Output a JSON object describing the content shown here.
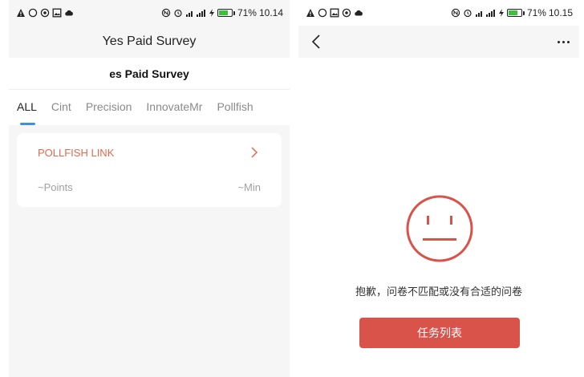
{
  "left_phone": {
    "status_bar": {
      "icons": [
        "warning-icon",
        "chat-bubble-icon",
        "circle-badge-icon",
        "image-icon",
        "cloud-icon"
      ],
      "right_icons": [
        "nfc-icon",
        "alarm-icon",
        "signal-icon",
        "charging-icon"
      ],
      "battery_percent": "71%",
      "battery_level": 0.71,
      "time": "10.14"
    },
    "app_title": "Yes Paid Survey",
    "subtitle": "es Paid Survey",
    "tabs": [
      {
        "label": "ALL",
        "active": true
      },
      {
        "label": "Cint",
        "active": false
      },
      {
        "label": "Precision",
        "active": false
      },
      {
        "label": "InnovateMr",
        "active": false
      },
      {
        "label": "Pollfish",
        "active": false
      }
    ],
    "card": {
      "title": "POLLFISH LINK",
      "points": "~Points",
      "minutes": "~Min"
    }
  },
  "right_phone": {
    "status_bar": {
      "battery_percent": "71%",
      "battery_level": 0.71,
      "time": "10.15"
    },
    "empty_message": "抱歉，问卷不匹配或没有合适的问卷",
    "task_button": "任务列表"
  },
  "colors": {
    "accent_orange": "#e06a4e",
    "tab_indicator": "#3d8fe0",
    "button_red": "#d9534a",
    "battery_green": "#3cc13c"
  }
}
